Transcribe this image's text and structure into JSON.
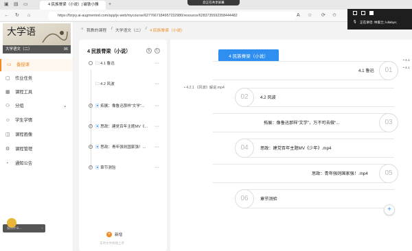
{
  "browser": {
    "tab_title": "4 民族脊梁（小说）| 磁铁小雅",
    "url": "https://fzrjxy.ai-augmented.com/app/jx-web/mycourse/62776671849572329​80/resource/6283735592358444482",
    "new_tab_label": "+"
  },
  "share_banner": {
    "label": "您正在共享屏幕"
  },
  "meeting": {
    "speaking_label": "正在讲话: 林俊兰; lullabye;"
  },
  "sidebar": {
    "course_cover_title": "大学语",
    "course_name": "大学语文（二）",
    "course_badge": "96",
    "items": [
      {
        "label": "备授课",
        "icon": "book-icon",
        "active": true
      },
      {
        "label": "作业任务",
        "icon": "task-icon"
      },
      {
        "label": "课程工具",
        "icon": "tools-icon"
      },
      {
        "label": "分组",
        "icon": "group-icon",
        "chevron": "⌄"
      },
      {
        "label": "学生学情",
        "icon": "student-icon"
      },
      {
        "label": "课程画像",
        "icon": "portrait-icon"
      },
      {
        "label": "课程管理",
        "icon": "settings-icon"
      },
      {
        "label": "通知公告",
        "icon": "bell-icon"
      }
    ],
    "feedback_label": "说点什么..."
  },
  "breadcrumb": {
    "home": "我教的课程",
    "course": "大学语文（二）",
    "sep": "/",
    "current": "4 民族脊梁（小说）"
  },
  "panel": {
    "title": "4 民族脊梁（小说）",
    "chapters": [
      {
        "label": "4.1 鲁迅",
        "kind": "folder"
      },
      {
        "label": "4.2 风波",
        "kind": "folder"
      },
      {
        "label": "拓展：像鲁迅那样“文学”...",
        "kind": "doc"
      },
      {
        "label": "思政：建党百年主题MV《...",
        "kind": "doc"
      },
      {
        "label": "思政：青年强则国家强！...",
        "kind": "doc"
      },
      {
        "label": "章节测验",
        "kind": "doc"
      }
    ],
    "more": "···",
    "new_label": "新增",
    "new_hint": "支持文件拖拽上传"
  },
  "main": {
    "title": "4 民族脊梁（小说）",
    "nodes": [
      {
        "num": "01",
        "text": "4.1 鲁迅"
      },
      {
        "num": "02",
        "text": "4.2 风波"
      },
      {
        "num": "03",
        "text": "拓展：像鲁迅那样“文学”，万不可去做“..."
      },
      {
        "num": "04",
        "text": "思政：建党百年主题MV《少年》.mp4"
      },
      {
        "num": "05",
        "text": "思政：青年强则国家强！.mp4"
      },
      {
        "num": "06",
        "text": "章节测验"
      }
    ],
    "sub_item": "• 4.2.1 《风波》解说.mp4",
    "edge_items": [
      "• 4.1",
      "• 4.1"
    ],
    "fab_label": "+"
  }
}
